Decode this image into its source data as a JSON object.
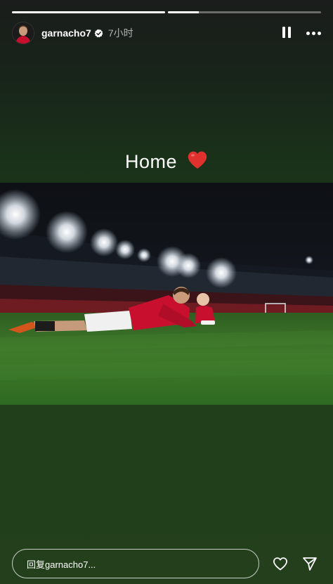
{
  "story": {
    "progress": [
      1.0,
      0.2
    ],
    "header": {
      "username": "garnacho7",
      "verified_icon": "verified-badge-icon",
      "time": "7小时",
      "pause_icon": "pause-icon",
      "more_icon": "more-icon"
    },
    "caption": "Home",
    "caption_emoji": "heart-icon",
    "reply_placeholder": "回复garnacho7...",
    "like_icon": "heart-outline-icon",
    "share_icon": "send-icon"
  },
  "colors": {
    "background_top": "#1a1d1b",
    "background_bottom": "#233f1c",
    "heart": "#e0312f",
    "jersey": "#c8102e"
  }
}
